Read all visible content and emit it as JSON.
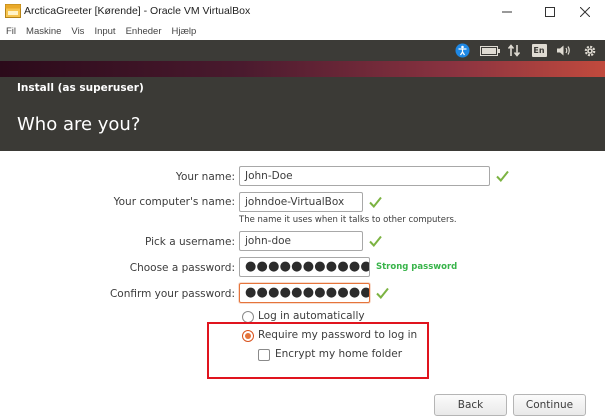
{
  "window": {
    "title": "ArcticaGreeter [Kørende] - Oracle VM VirtualBox",
    "minimize_glyph": "—",
    "maximize_glyph": "☐",
    "close_glyph": "✕"
  },
  "menubar": {
    "items": [
      "Fil",
      "Maskine",
      "Vis",
      "Input",
      "Enheder",
      "Hjælp"
    ]
  },
  "panel": {
    "icons": [
      "accessibility-icon",
      "battery-icon",
      "network-icon",
      "keyboard-layout-icon",
      "sound-icon",
      "settings-gear-icon"
    ],
    "keyboard_layout": "En"
  },
  "installer": {
    "window_title": "Install (as superuser)",
    "heading": "Who are you?"
  },
  "form": {
    "name_label": "Your name:",
    "name_value": "John-Doe",
    "computer_label": "Your computer's name:",
    "computer_value": "johndoe-VirtualBox",
    "computer_hint": "The name it uses when it talks to other computers.",
    "username_label": "Pick a username:",
    "username_value": "john-doe",
    "password_label": "Choose a password:",
    "password_value": "●●●●●●●●●●●●",
    "password_strength": "Strong password",
    "confirm_label": "Confirm your password:",
    "confirm_value": "●●●●●●●●●●●●",
    "login_auto_label": "Log in automatically",
    "login_require_label": "Require my password to log in",
    "encrypt_label": "Encrypt my home folder",
    "selected_login_option": "Require my password to log in",
    "encrypt_checked": false
  },
  "buttons": {
    "back": "Back",
    "continue": "Continue"
  },
  "colors": {
    "accent_orange": "#e5743b",
    "valid_green": "#7cb342",
    "strength_green": "#38b44a",
    "highlight_red": "#e0141e",
    "panel_dark": "#3c3b37"
  }
}
